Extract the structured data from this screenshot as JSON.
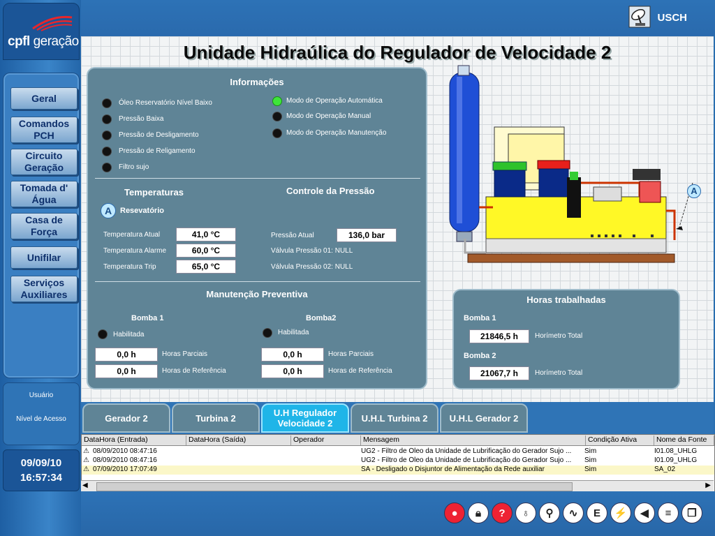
{
  "brand": {
    "name": "cpfl",
    "suffix": "geração"
  },
  "topbar": {
    "station": "USCH"
  },
  "title": "Unidade Hidraúlica do Regulador de Velocidade 2",
  "menu": [
    {
      "label": "Geral"
    },
    {
      "label": "Comandos PCH"
    },
    {
      "label": "Circuito Geração"
    },
    {
      "label": "Tomada d' Água"
    },
    {
      "label": "Casa de Força"
    },
    {
      "label": "Unifilar"
    },
    {
      "label": "Serviços Auxiliares"
    }
  ],
  "user": {
    "user_label": "Usuário",
    "access_label": "Nível de Acesso"
  },
  "clock": {
    "date": "09/09/10",
    "time": "16:57:34"
  },
  "info": {
    "title": "Informações",
    "left_items": [
      {
        "label": "Óleo Reservatório Nível Baixo",
        "state": "off"
      },
      {
        "label": "Pressão  Baixa",
        "state": "off"
      },
      {
        "label": "Pressão de Desligamento",
        "state": "off"
      },
      {
        "label": "Pressão de Religamento",
        "state": "off"
      },
      {
        "label": "Filtro sujo",
        "state": "off"
      }
    ],
    "right_items": [
      {
        "label": "Modo de Operação Automática",
        "state": "on"
      },
      {
        "label": "Modo de Operação Manual",
        "state": "off"
      },
      {
        "label": "Modo de Operação Manutenção",
        "state": "off"
      }
    ],
    "temperatures": {
      "title": "Temperaturas",
      "marker": "A",
      "reservoir_label": "Resevatório",
      "rows": [
        {
          "label": "Temperatura  Atual",
          "value": "41,0 °C"
        },
        {
          "label": "Temperatura Alarme",
          "value": "60,0 °C"
        },
        {
          "label": "Temperatura Trip",
          "value": "65,0 °C"
        }
      ]
    },
    "pressure": {
      "title": "Controle da Pressão",
      "current_label": "Pressão  Atual",
      "current_value": "136,0 bar",
      "valve1": "Válvula Pressão 01:  NULL",
      "valve2": "Válvula Pressão 02:  NULL"
    },
    "maintenance": {
      "title": "Manutenção Preventiva",
      "pump1": {
        "title": "Bomba 1",
        "enabled_label": "Habilitada",
        "partial_value": "0,0 h",
        "partial_label": "Horas Parciais",
        "ref_value": "0,0 h",
        "ref_label": "Horas de Referência"
      },
      "pump2": {
        "title": "Bomba2",
        "enabled_label": "Habilitada",
        "partial_value": "0,0 h",
        "partial_label": "Horas Parciais",
        "ref_value": "0,0 h",
        "ref_label": "Horas de Referência"
      }
    }
  },
  "hours": {
    "title": "Horas trabalhadas",
    "pump1": {
      "title": "Bomba 1",
      "value": "21846,5 h",
      "label": "Horímetro Total"
    },
    "pump2": {
      "title": "Bomba 2",
      "value": "21067,7 h",
      "label": "Horímetro Total"
    }
  },
  "equipment": {
    "marker": "A"
  },
  "tabs": [
    {
      "label": "Gerador 2",
      "active": false
    },
    {
      "label": "Turbina 2",
      "active": false
    },
    {
      "label": "U.H Regulador Velocidade 2",
      "active": true
    },
    {
      "label": "U.H.L Turbina 2",
      "active": false
    },
    {
      "label": "U.H.L Gerador 2",
      "active": false
    }
  ],
  "alarms": {
    "columns": [
      "DataHora (Entrada)",
      "DataHora (Saída)",
      "Operador",
      "Mensagem",
      "Condição Ativa",
      "Nome da Fonte"
    ],
    "rows": [
      {
        "entrada": "08/09/2010 08:47:16",
        "saida": "",
        "operador": "",
        "mensagem": "UG2 - Filtro de Óleo da Unidade de Lubrificação do Gerador Sujo ...",
        "ativa": "Sim",
        "fonte": "I01.08_UHLG"
      },
      {
        "entrada": "08/09/2010 08:47:16",
        "saida": "",
        "operador": "",
        "mensagem": "UG2 - Filtro de Óleo da Unidade de Lubrificação do Gerador Sujo ...",
        "ativa": "Sim",
        "fonte": "I01.09_UHLG"
      },
      {
        "entrada": "07/09/2010 17:07:49",
        "saida": "",
        "operador": "",
        "mensagem": "SA - Desligado o Disjuntor de Alimentação da Rede auxiliar",
        "ativa": "Sim",
        "fonte": "SA_02"
      }
    ]
  },
  "toolbar_icons": [
    "alarm-bell-icon",
    "lock-icon",
    "help-icon",
    "lamp-icon",
    "walker-icon",
    "trend-chart-icon",
    "events-icon",
    "network-icon",
    "speaker-icon",
    "report-icon",
    "window-icon"
  ],
  "colors": {
    "panel": "#5f8496",
    "indicator_on": "#3ee63a",
    "indicator_off": "#111111",
    "active_tab": "#1fb5e8"
  }
}
